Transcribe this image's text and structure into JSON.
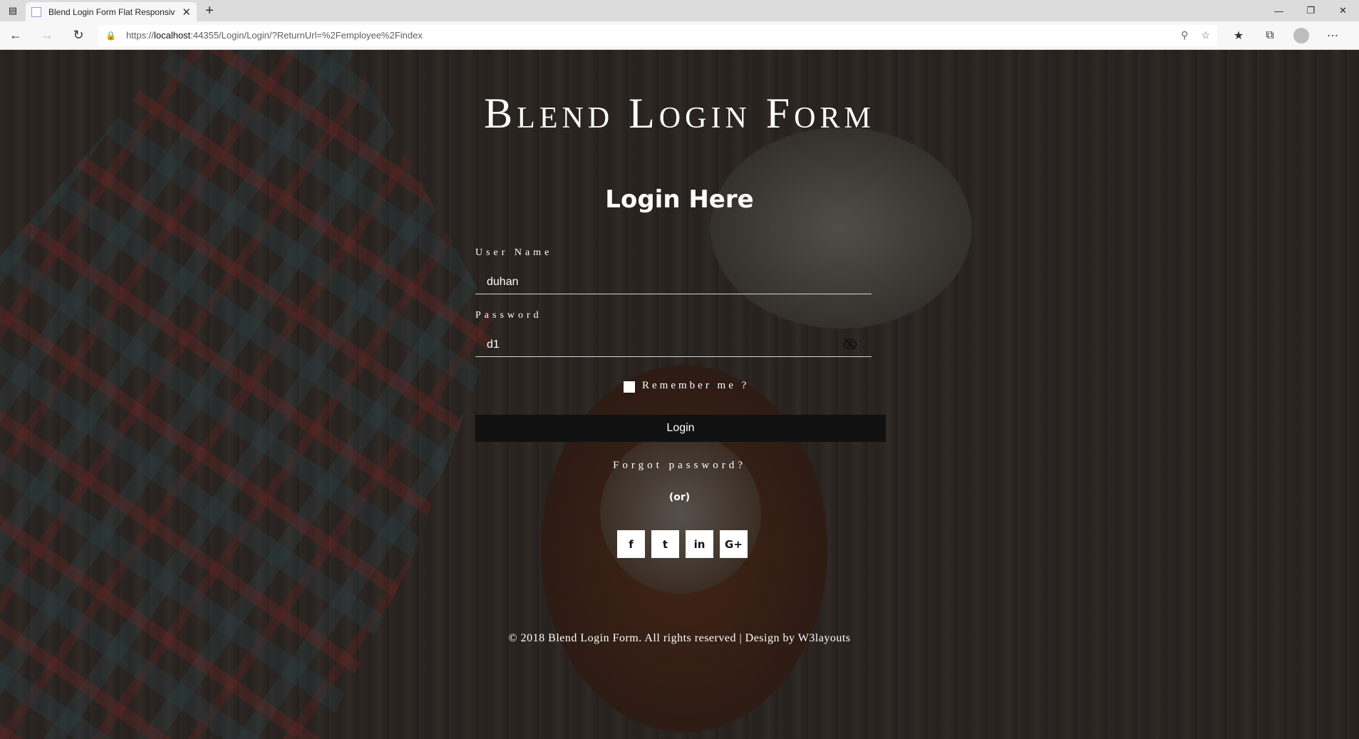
{
  "browser": {
    "tab_title": "Blend Login Form Flat Responsiv",
    "url_prefix": "https://",
    "url_host": "localhost",
    "url_rest": ":44355/Login/Login/?ReturnUrl=%2Femployee%2Findex"
  },
  "page": {
    "brand_title": "Blend Login Form",
    "heading": "Login Here",
    "username": {
      "label": "User Name",
      "value": "duhan"
    },
    "password": {
      "label": "Password",
      "value": "d1"
    },
    "remember_label": "Remember me ?",
    "login_label": "Login",
    "forgot_label": "Forgot password?",
    "or_label": "(or)",
    "socials": {
      "facebook": "f",
      "twitter": "t",
      "linkedin": "in",
      "google": "G+"
    },
    "footer": "© 2018 Blend Login Form. All rights reserved | Design by W3layouts"
  }
}
